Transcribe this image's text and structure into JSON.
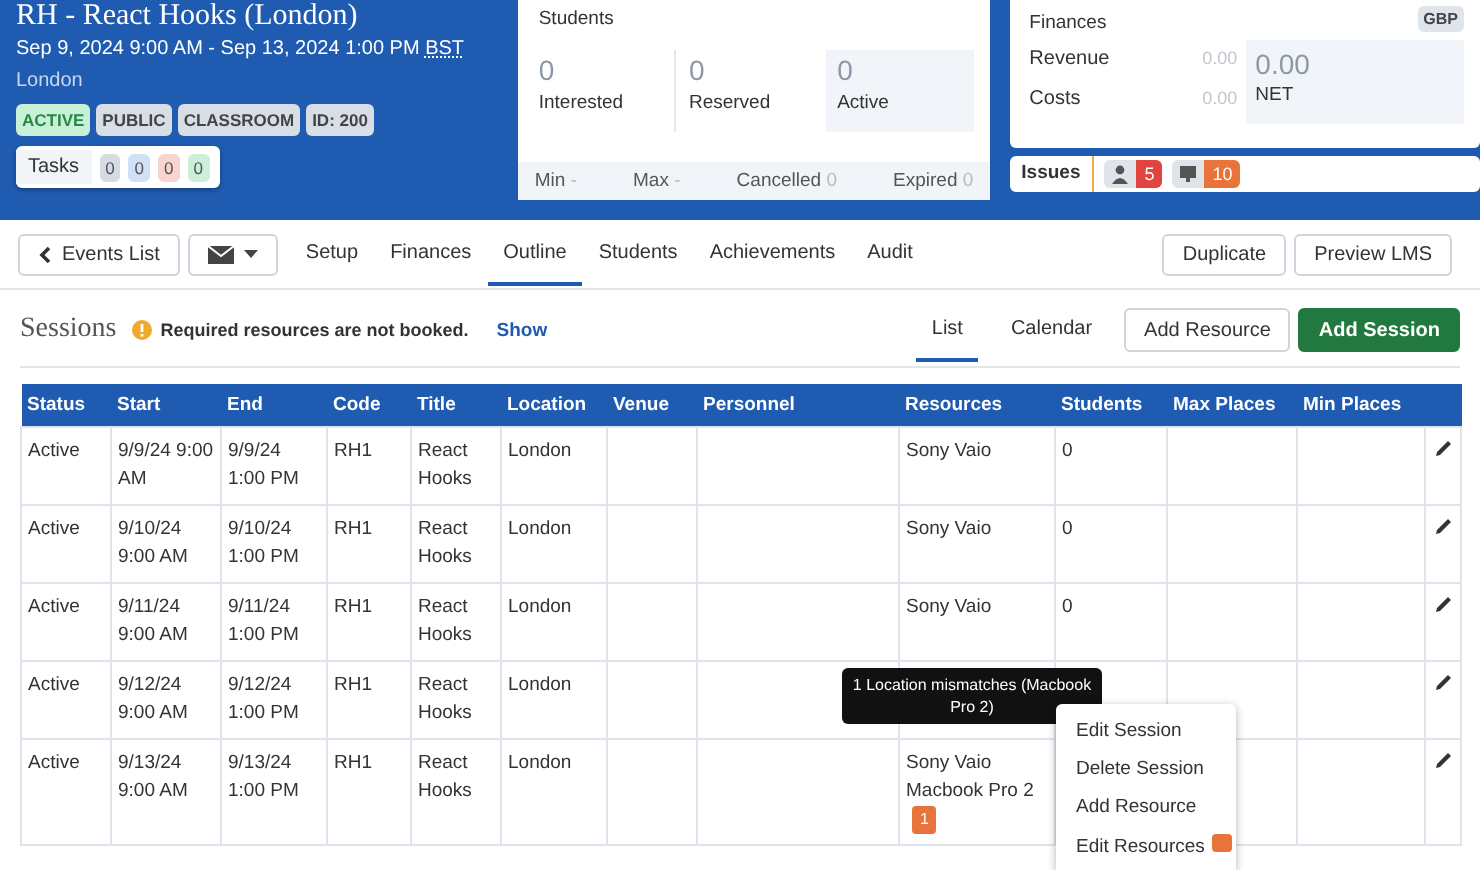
{
  "event": {
    "title": "RH - React Hooks (London)",
    "dates": "Sep 9, 2024 9:00 AM - Sep 13, 2024 1:00 PM",
    "timezone": "BST",
    "location": "London",
    "tags": [
      {
        "label": "ACTIVE",
        "kind": "status"
      },
      {
        "label": "PUBLIC",
        "kind": "plain"
      },
      {
        "label": "CLASSROOM",
        "kind": "plain"
      },
      {
        "label": "ID: 200",
        "kind": "plain"
      }
    ],
    "tasks": {
      "label": "Tasks",
      "counts": [
        {
          "value": "0",
          "color": "#d5dbe3"
        },
        {
          "value": "0",
          "color": "#cfe0f7"
        },
        {
          "value": "0",
          "color": "#f7d4cf"
        },
        {
          "value": "0",
          "color": "#cdeed8"
        }
      ]
    }
  },
  "students": {
    "title": "Students",
    "stats": [
      {
        "value": "0",
        "label": "Interested"
      },
      {
        "value": "0",
        "label": "Reserved"
      },
      {
        "value": "0",
        "label": "Active"
      }
    ],
    "footer": [
      {
        "label": "Min",
        "value": "-"
      },
      {
        "label": "Max",
        "value": "-"
      },
      {
        "label": "Cancelled",
        "value": "0"
      },
      {
        "label": "Expired",
        "value": "0"
      }
    ]
  },
  "finances": {
    "title": "Finances",
    "currency": "GBP",
    "rows": [
      {
        "label": "Revenue",
        "value": "0.00"
      },
      {
        "label": "Costs",
        "value": "0.00"
      }
    ],
    "net_value": "0.00",
    "net_label": "NET"
  },
  "issues": {
    "label": "Issues",
    "items": [
      {
        "kind": "person",
        "count": "5",
        "color": "#e0443e"
      },
      {
        "kind": "screen",
        "count": "10",
        "color": "#e8743b"
      }
    ]
  },
  "nav": {
    "back": "Events List",
    "tabs": [
      {
        "label": "Setup",
        "selected": false
      },
      {
        "label": "Finances",
        "selected": false
      },
      {
        "label": "Outline",
        "selected": true
      },
      {
        "label": "Students",
        "selected": false
      },
      {
        "label": "Achievements",
        "selected": false
      },
      {
        "label": "Audit",
        "selected": false
      }
    ],
    "actions": [
      "Duplicate",
      "Preview LMS"
    ]
  },
  "sessions": {
    "title": "Sessions",
    "warning": "Required resources are not booked.",
    "show_link": "Show",
    "views": [
      {
        "label": "List",
        "selected": true
      },
      {
        "label": "Calendar",
        "selected": false
      }
    ],
    "add_resource": "Add Resource",
    "add_session": "Add Session"
  },
  "table": {
    "columns": [
      "Status",
      "Start",
      "End",
      "Code",
      "Title",
      "Location",
      "Venue",
      "Personnel",
      "Resources",
      "Students",
      "Max Places",
      "Min Places"
    ],
    "rows": [
      {
        "status": "Active",
        "start": "9/9/24 9:00 AM",
        "end": "9/9/24 1:00 PM",
        "code": "RH1",
        "title": "React Hooks",
        "location": "London",
        "resources": [
          "Sony Vaio"
        ],
        "students": "0"
      },
      {
        "status": "Active",
        "start": "9/10/24 9:00 AM",
        "end": "9/10/24 1:00 PM",
        "code": "RH1",
        "title": "React Hooks",
        "location": "London",
        "resources": [
          "Sony Vaio"
        ],
        "students": "0"
      },
      {
        "status": "Active",
        "start": "9/11/24 9:00 AM",
        "end": "9/11/24 1:00 PM",
        "code": "RH1",
        "title": "React Hooks",
        "location": "London",
        "resources": [
          "Sony Vaio"
        ],
        "students": "0"
      },
      {
        "status": "Active",
        "start": "9/12/24 9:00 AM",
        "end": "9/12/24 1:00 PM",
        "code": "RH1",
        "title": "React Hooks",
        "location": "London",
        "resources": [],
        "students": ""
      },
      {
        "status": "Active",
        "start": "9/13/24 9:00 AM",
        "end": "9/13/24 1:00 PM",
        "code": "RH1",
        "title": "React Hooks",
        "location": "London",
        "resources": [
          "Sony Vaio",
          "Macbook Pro 2"
        ],
        "resource_badge": "1",
        "students": ""
      }
    ]
  },
  "tooltip": "1 Location mismatches (Macbook Pro 2)",
  "context_menu": [
    "Edit Session",
    "Delete Session",
    "Add Resource",
    "Edit Resources"
  ]
}
